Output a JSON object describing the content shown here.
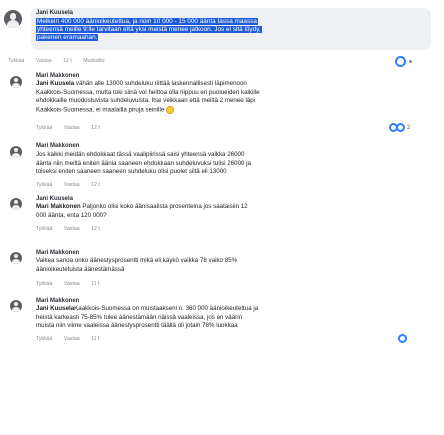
{
  "top": {
    "author": "Jani Kuusela",
    "highlight_lines": [
      "Melkein 400 000 äänioikeutettua, ja noin 10 000 - 15 000 äänta tassa maassa",
      "yhteensä meille 9:lle tarvitaan että yksi meistä menee jatkoon. Jos ei sitä löydy,",
      "pakenen eramaahan."
    ],
    "actions": [
      "Tykkää",
      "Vastaa",
      "12 t",
      "Muokattu"
    ]
  },
  "comments": [
    {
      "author": "Mari Makkonen",
      "lines": [
        "Jani Kuusela vähän alle 13000 suhdeluku riittää laskennallisesti läpimenoon",
        "Kaakkois-Suomessa, mutta toki siinä voi heittoa olla riippuu eri puolueiden kaikille",
        "ehdokkaille muodostuvista suhdeluvuista. Itse veikkaan että meiltä 2 menee läpi",
        "Kaakkois-Suomessa, ei maalailla piruja seinille"
      ],
      "bold_prefix": "Jani Kuusela",
      "actions": [
        "Tykkää",
        "Vastaa",
        "12 t"
      ],
      "reaction_count": "2"
    },
    {
      "author": "Mari Makkonen",
      "lines": [
        "Jos kaikki meidän ehdokkaat tässä vaalipiirissä saisi yhteensä vaikka 26000",
        "äänta niin meiltä eniten äänia saaneen ehdokkaan suhdeluvuksi tulisi 26000 ja",
        "toiseksi eniten saaneen saaneen suhdeluku olisi puolet siitä eli 13000"
      ],
      "actions": [
        "Tykkää",
        "Vastaa",
        "12 t"
      ]
    },
    {
      "author": "Jani Kuusela",
      "lines": [
        "Mari Makkonen Paljonko olisi koko äänisaalista prosenteina jos saataisiin 12",
        "000 äänta, enta 120 000?"
      ],
      "bold_prefix": "Mari Makkonen",
      "actions": [
        "Tykkää",
        "Vastaa",
        "12 t"
      ]
    },
    {
      "author": "Mari Makkonen",
      "lines": [
        "Vaikea sanoa onko äänestysprosentti mikä eli käykö vaikka 78 vaiko 85%",
        "äänioikeutetuista äänestämässä"
      ],
      "actions": [
        "Tykkää",
        "Vastaa",
        "11 t"
      ]
    },
    {
      "author": "Mari Makkonen",
      "lines": [
        "Jani KuuselaKaakkois-Suomessa on muistaakseni n. 360 000 äänioikeutettua ja",
        "heistä karkeasti 75-85% tulee äänestämään näissä vaaleissa, jos en väärin",
        "muista niin viime vaaleissa äänestysprosentti täällä oli jotain 78% luokkaa"
      ],
      "bold_prefix": "Jani Kuusela",
      "actions": [
        "Tykkää",
        "Vastaa",
        "11 t"
      ]
    }
  ],
  "colors": {
    "highlight": "#1e5bd6",
    "accent": "#2f80ff"
  }
}
